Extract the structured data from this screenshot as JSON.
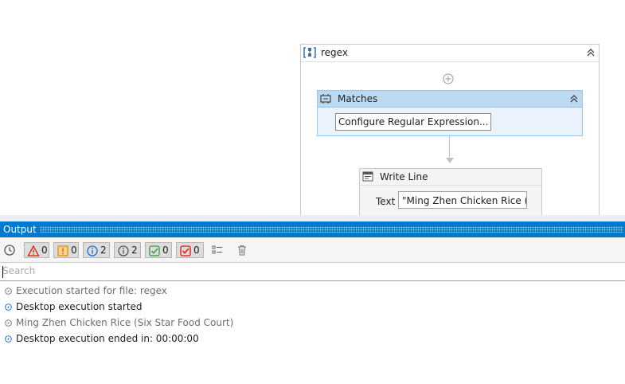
{
  "designer": {
    "sequence": {
      "title": "regex",
      "icon": "sequence-icon"
    },
    "matches": {
      "title": "Matches",
      "icon": "matches-activity-icon",
      "configure_button": "Configure Regular Expression..."
    },
    "write_line": {
      "title": "Write Line",
      "icon": "write-line-icon",
      "text_label": "Text",
      "text_value": "\"Ming Zhen Chicken Rice (Six"
    }
  },
  "output": {
    "title": "Output",
    "toolbar": {
      "errors": "0",
      "warnings": "0",
      "info": "2",
      "trace": "2",
      "success": "0",
      "fail": "0"
    },
    "search": {
      "placeholder": "Search",
      "value": ""
    },
    "log": [
      {
        "level": "trace",
        "text": "Execution started for file: regex"
      },
      {
        "level": "info",
        "text": "Desktop execution started"
      },
      {
        "level": "trace",
        "text": "Ming Zhen Chicken Rice (Six Star Food Court)"
      },
      {
        "level": "info",
        "text": "Desktop execution ended in: 00:00:00"
      }
    ]
  },
  "colors": {
    "accent": "#007acc",
    "matches_header": "#bcd9f2",
    "info_icon": "#1f6fd6",
    "error_icon": "#e51400",
    "success_icon": "#3c9a3c"
  }
}
